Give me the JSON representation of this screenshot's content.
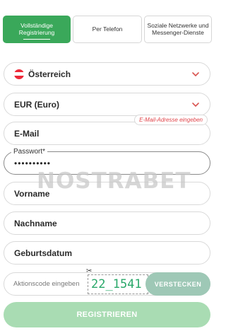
{
  "tabs": [
    {
      "label_line1": "Vollständige",
      "label_line2": "Registrierung"
    },
    {
      "label_line1": "Per Telefon",
      "label_line2": ""
    },
    {
      "label_line1": "Soziale Netzwerke und",
      "label_line2": "Messenger-Dienste"
    }
  ],
  "country": {
    "value": "Österreich",
    "icon": "austria-flag-icon",
    "flag_colors": [
      "#ed2939",
      "#ffffff",
      "#ed2939"
    ]
  },
  "currency": {
    "value": "EUR (Euro)"
  },
  "email": {
    "value": "E-Mail",
    "error": "E-Mail-Adresse eingeben"
  },
  "password": {
    "label": "Passwort",
    "required_mark": "*",
    "masked_value": "••••••••••"
  },
  "watermark": "NOSTRABET",
  "first_name": {
    "value": "Vorname"
  },
  "last_name": {
    "value": "Nachname"
  },
  "birthdate": {
    "value": "Geburtsdatum"
  },
  "promo": {
    "placeholder": "Aktionscode eingeben",
    "code": "22_1541",
    "button": "VERSTECKEN"
  },
  "submit": {
    "label": "REGISTRIEREN"
  },
  "colors": {
    "accent": "#3aa85a",
    "error": "#e0444a",
    "chevron": "#d9534f",
    "submit_bg": "#a9dcb3"
  }
}
